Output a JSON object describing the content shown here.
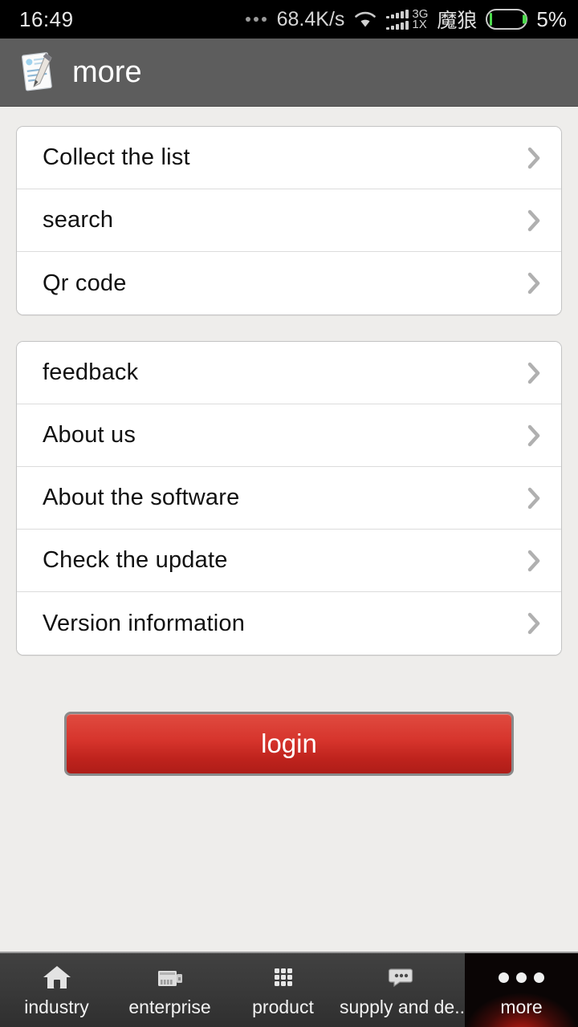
{
  "status_bar": {
    "time": "16:49",
    "net_speed": "68.4K/s",
    "overflow_icon": "three-dots-icon",
    "wifi_icon": "wifi-icon",
    "signal_icon": "signal-bars-icon",
    "signal_label_top": "3G",
    "signal_label_bottom": "1X",
    "carrier": "魔狼",
    "battery_icon": "battery-icon",
    "battery_percent": "5%",
    "battery_fill_color": "#4ddb4d",
    "background_color": "#000000"
  },
  "header": {
    "icon": "document-pen-icon",
    "title": "more",
    "background_color": "#5d5d5d"
  },
  "lists": [
    {
      "group_name": "tools-group",
      "items": [
        {
          "label": "Collect the list",
          "chevron": "chevron-right-icon"
        },
        {
          "label": "search",
          "chevron": "chevron-right-icon"
        },
        {
          "label": "Qr code",
          "chevron": "chevron-right-icon"
        }
      ]
    },
    {
      "group_name": "info-group",
      "items": [
        {
          "label": "feedback",
          "chevron": "chevron-right-icon"
        },
        {
          "label": "About us",
          "chevron": "chevron-right-icon"
        },
        {
          "label": "About the software",
          "chevron": "chevron-right-icon"
        },
        {
          "label": "Check the update",
          "chevron": "chevron-right-icon"
        },
        {
          "label": "Version information",
          "chevron": "chevron-right-icon"
        }
      ]
    }
  ],
  "login": {
    "label": "login",
    "color_top": "#e04b40",
    "color_bottom": "#ae1d18"
  },
  "bottom_nav": {
    "active_index": 4,
    "items": [
      {
        "label": "industry",
        "icon": "home-icon"
      },
      {
        "label": "enterprise",
        "icon": "factory-icon"
      },
      {
        "label": "product",
        "icon": "grid-icon"
      },
      {
        "label": "supply and de..",
        "icon": "chat-bubble-icon"
      },
      {
        "label": "more",
        "icon": "three-dots-icon"
      }
    ]
  },
  "page_background_color": "#eeedeb"
}
